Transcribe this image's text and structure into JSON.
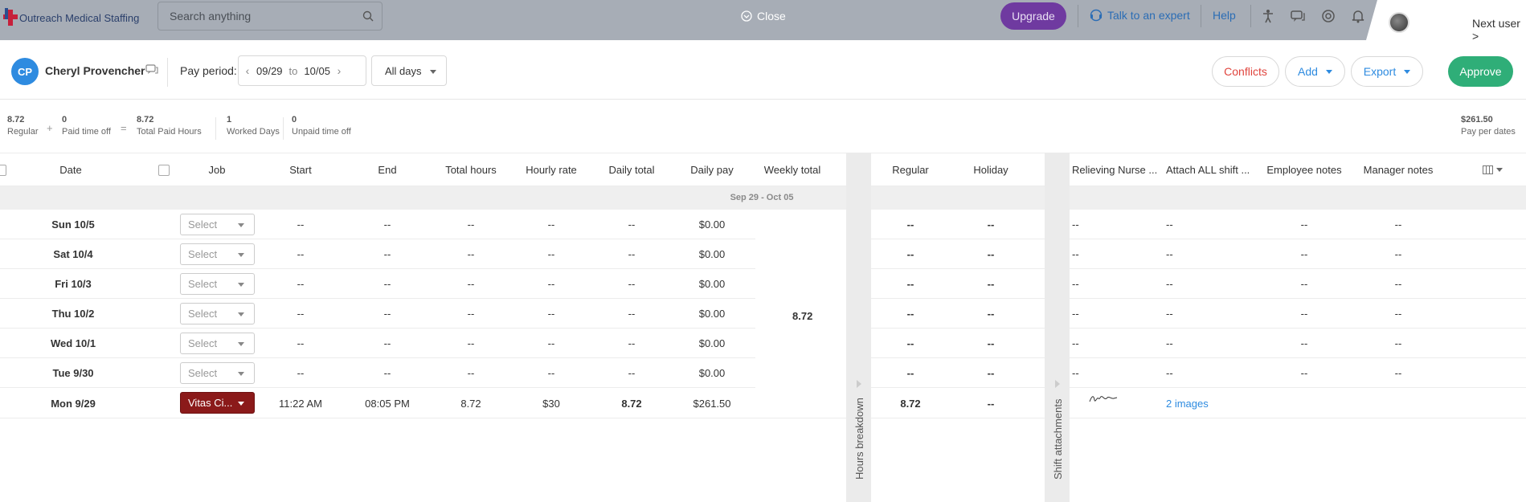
{
  "topbar": {
    "brand": "Outreach Medical Staffing",
    "search_placeholder": "Search anything",
    "close_label": "Close",
    "upgrade_label": "Upgrade",
    "expert_label": "Talk to an expert",
    "help_label": "Help",
    "next_user_label": "Next user >",
    "icons": [
      "accessibility-icon",
      "chat-icon",
      "support-icon",
      "bell-icon"
    ]
  },
  "header": {
    "avatar_initials": "CP",
    "employee_name": "Cheryl Provencher",
    "pay_period_label": "Pay period:",
    "period_start": "09/29",
    "period_to": "to",
    "period_end": "10/05",
    "days_filter": "All days",
    "conflicts_label": "Conflicts",
    "add_label": "Add",
    "export_label": "Export",
    "approve_label": "Approve"
  },
  "summary": {
    "regular_value": "8.72",
    "regular_label": "Regular",
    "plus": "+",
    "pto_value": "0",
    "pto_label": "Paid time off",
    "equals": "=",
    "total_paid_value": "8.72",
    "total_paid_label": "Total Paid Hours",
    "worked_days_value": "1",
    "worked_days_label": "Worked Days",
    "unpaid_value": "0",
    "unpaid_label": "Unpaid time off",
    "pay_value": "$261.50",
    "pay_label": "Pay per dates"
  },
  "table": {
    "columns": {
      "date": "Date",
      "job": "Job",
      "start": "Start",
      "end": "End",
      "total_hours": "Total hours",
      "hourly_rate": "Hourly rate",
      "daily_total": "Daily total",
      "daily_pay": "Daily pay",
      "weekly_total": "Weekly total",
      "regular": "Regular",
      "holiday": "Holiday",
      "relieving_nurse": "Relieving Nurse ...",
      "attach_shift": "Attach ALL shift ...",
      "employee_notes": "Employee notes",
      "manager_notes": "Manager notes"
    },
    "week_band": "Sep 29 - Oct 05",
    "weekly_total_value": "8.72",
    "section_hours_breakdown": "Hours breakdown",
    "section_shift_attachments": "Shift attachments",
    "rows": [
      {
        "date": "Sun 10/5",
        "job": "Select",
        "start": "--",
        "end": "--",
        "total_hours": "--",
        "rate": "--",
        "daily_total": "--",
        "daily_pay": "$0.00",
        "regular": "--",
        "holiday": "--",
        "relieving": "--",
        "attach": "--",
        "emp_notes": "--",
        "mgr_notes": "--"
      },
      {
        "date": "Sat 10/4",
        "job": "Select",
        "start": "--",
        "end": "--",
        "total_hours": "--",
        "rate": "--",
        "daily_total": "--",
        "daily_pay": "$0.00",
        "regular": "--",
        "holiday": "--",
        "relieving": "--",
        "attach": "--",
        "emp_notes": "--",
        "mgr_notes": "--"
      },
      {
        "date": "Fri 10/3",
        "job": "Select",
        "start": "--",
        "end": "--",
        "total_hours": "--",
        "rate": "--",
        "daily_total": "--",
        "daily_pay": "$0.00",
        "regular": "--",
        "holiday": "--",
        "relieving": "--",
        "attach": "--",
        "emp_notes": "--",
        "mgr_notes": "--"
      },
      {
        "date": "Thu 10/2",
        "job": "Select",
        "start": "--",
        "end": "--",
        "total_hours": "--",
        "rate": "--",
        "daily_total": "--",
        "daily_pay": "$0.00",
        "regular": "--",
        "holiday": "--",
        "relieving": "--",
        "attach": "--",
        "emp_notes": "--",
        "mgr_notes": "--"
      },
      {
        "date": "Wed 10/1",
        "job": "Select",
        "start": "--",
        "end": "--",
        "total_hours": "--",
        "rate": "--",
        "daily_total": "--",
        "daily_pay": "$0.00",
        "regular": "--",
        "holiday": "--",
        "relieving": "--",
        "attach": "--",
        "emp_notes": "--",
        "mgr_notes": "--"
      },
      {
        "date": "Tue 9/30",
        "job": "Select",
        "start": "--",
        "end": "--",
        "total_hours": "--",
        "rate": "--",
        "daily_total": "--",
        "daily_pay": "$0.00",
        "regular": "--",
        "holiday": "--",
        "relieving": "--",
        "attach": "--",
        "emp_notes": "--",
        "mgr_notes": "--"
      },
      {
        "date": "Mon 9/29",
        "job": "Vitas Ci...",
        "start": "11:22 AM",
        "end": "08:05 PM",
        "total_hours": "8.72",
        "rate": "$30",
        "daily_total": "8.72",
        "daily_pay": "$261.50",
        "regular": "8.72",
        "holiday": "--",
        "relieving": "",
        "attach": "2 images",
        "emp_notes": "",
        "mgr_notes": ""
      }
    ]
  }
}
